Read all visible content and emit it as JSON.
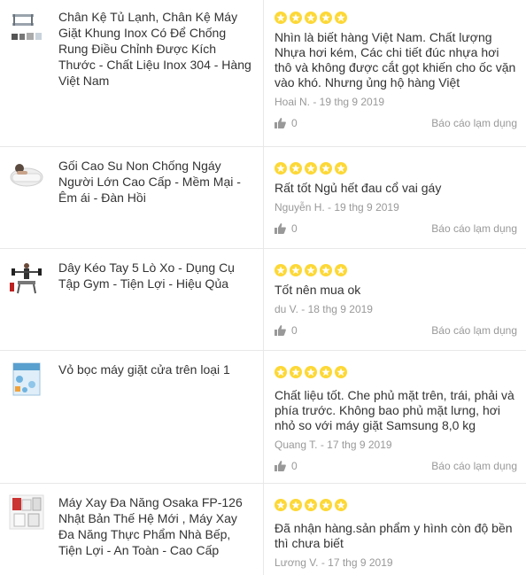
{
  "reviews": [
    {
      "product_name": "Chân Kệ Tủ Lạnh, Chân Kệ Máy Giặt Khung Inox Có Để Chống Rung Điều Chỉnh Được Kích Thước - Chất Liệu Inox 304 - Hàng Việt Nam",
      "thumb_icon": "washing-stand-image",
      "rating": 5,
      "comment": "Nhìn là biết hàng Việt Nam. Chất lượng Nhựa hơi kém, Các chi tiết đúc nhựa hơi thô và không được cắt gọt khiến cho ốc vặn vào khó. Nhưng ủng hộ hàng Việt",
      "author": "Hoai N. - 19 thg 9 2019",
      "likes": "0",
      "report_label": "Báo cáo lạm dụng"
    },
    {
      "product_name": "Gối Cao Su Non Chống Ngáy Người Lớn Cao Cấp - Mềm Mại - Êm ái - Đàn Hồi",
      "thumb_icon": "pillow-image",
      "rating": 5,
      "comment": "Rất tốt Ngủ hết đau cổ vai gáy",
      "author": "Nguyễn H. - 19 thg 9 2019",
      "likes": "0",
      "report_label": "Báo cáo lạm dụng"
    },
    {
      "product_name": "Dây Kéo Tay 5 Lò Xo - Dụng Cụ Tập Gym - Tiện Lợi - Hiệu Qủa",
      "thumb_icon": "spring-expander-image",
      "rating": 5,
      "comment": "Tốt nên mua ok",
      "author": "du V. - 18 thg 9 2019",
      "likes": "0",
      "report_label": "Báo cáo lạm dụng"
    },
    {
      "product_name": "Vỏ bọc máy giặt cửa trên loại 1",
      "thumb_icon": "washer-cover-image",
      "rating": 5,
      "comment": "Chất liệu tốt. Che phủ mặt trên, trái, phải và phía trước. Không bao phủ mặt lưng, hơi nhỏ so với máy giặt Samsung 8,0 kg",
      "author": "Quang T. - 17 thg 9 2019",
      "likes": "0",
      "report_label": "Báo cáo lạm dụng"
    },
    {
      "product_name": "Máy Xay Đa Năng Osaka FP-126 Nhật Bản Thế Hệ Mới , Máy Xay Đa Năng Thực Phẩm Nhà Bếp, Tiện Lợi - An Toàn - Cao Cấp",
      "thumb_icon": "food-processor-image",
      "rating": 5,
      "comment": "Đã nhận hàng.sản phẩm y hình còn độ bền thì chưa biết",
      "author": "Lương V. - 17 thg 9 2019",
      "likes": "",
      "report_label": ""
    }
  ],
  "colors": {
    "star": "#fdd836",
    "divider": "#e8e8e8",
    "muted": "#999999"
  }
}
